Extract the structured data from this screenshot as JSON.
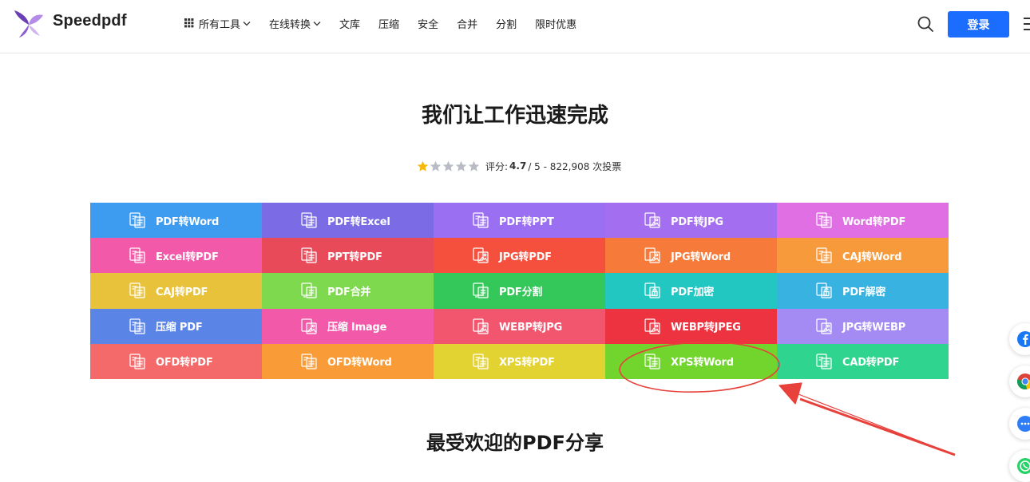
{
  "brand": {
    "name": "Speedpdf"
  },
  "nav": {
    "items": [
      {
        "label": "所有工具",
        "grid_icon": true,
        "dropdown": true
      },
      {
        "label": "在线转换",
        "grid_icon": false,
        "dropdown": true
      },
      {
        "label": "文库",
        "grid_icon": false,
        "dropdown": false
      },
      {
        "label": "压缩",
        "grid_icon": false,
        "dropdown": false
      },
      {
        "label": "安全",
        "grid_icon": false,
        "dropdown": false
      },
      {
        "label": "合并",
        "grid_icon": false,
        "dropdown": false
      },
      {
        "label": "分割",
        "grid_icon": false,
        "dropdown": false
      },
      {
        "label": "限时优惠",
        "grid_icon": false,
        "dropdown": false
      }
    ],
    "login_label": "登录"
  },
  "hero": {
    "title": "我们让工作迅速完成",
    "rating": {
      "label": "评分:",
      "score": "4.7",
      "rest": "/ 5 - 822,908 次投票",
      "stars_total": 5,
      "stars_filled": 1
    }
  },
  "tools": [
    {
      "label": "PDF转Word",
      "color": "#3d9cf0",
      "icon": "pdf-doc-icon"
    },
    {
      "label": "PDF转Excel",
      "color": "#7b6ce6",
      "icon": "pdf-doc-icon"
    },
    {
      "label": "PDF转PPT",
      "color": "#9b6ff2",
      "icon": "pdf-doc-icon"
    },
    {
      "label": "PDF转JPG",
      "color": "#a46ef0",
      "icon": "pdf-image-icon"
    },
    {
      "label": "Word转PDF",
      "color": "#df6fe3",
      "icon": "word-doc-icon"
    },
    {
      "label": "Excel转PDF",
      "color": "#f25aa9",
      "icon": "excel-doc-icon"
    },
    {
      "label": "PPT转PDF",
      "color": "#e84a5a",
      "icon": "ppt-doc-icon"
    },
    {
      "label": "JPG转PDF",
      "color": "#f5503d",
      "icon": "image-doc-icon"
    },
    {
      "label": "JPG转Word",
      "color": "#f67a3a",
      "icon": "image-doc-icon"
    },
    {
      "label": "CAJ转Word",
      "color": "#f79a3c",
      "icon": "caj-doc-icon"
    },
    {
      "label": "CAJ转PDF",
      "color": "#e8c23a",
      "icon": "caj-doc-icon"
    },
    {
      "label": "PDF合并",
      "color": "#7fd94e",
      "icon": "merge-icon"
    },
    {
      "label": "PDF分割",
      "color": "#34c759",
      "icon": "split-icon"
    },
    {
      "label": "PDF加密",
      "color": "#22c7c2",
      "icon": "lock-icon"
    },
    {
      "label": "PDF解密",
      "color": "#38b2e0",
      "icon": "unlock-icon"
    },
    {
      "label": "压缩 PDF",
      "color": "#5a84e6",
      "icon": "compress-pdf-icon"
    },
    {
      "label": "压缩 Image",
      "color": "#f25aa9",
      "icon": "compress-image-icon"
    },
    {
      "label": "WEBP转JPG",
      "color": "#f2566e",
      "icon": "webp-image-icon"
    },
    {
      "label": "WEBP转JPEG",
      "color": "#ee3340",
      "icon": "webp-image-icon"
    },
    {
      "label": "JPG转WEBP",
      "color": "#a38bf3",
      "icon": "jpg-image-icon"
    },
    {
      "label": "OFD转PDF",
      "color": "#f46a6a",
      "icon": "ofd-doc-icon"
    },
    {
      "label": "OFD转Word",
      "color": "#f99c38",
      "icon": "ofd-doc-icon"
    },
    {
      "label": "XPS转PDF",
      "color": "#e2d232",
      "icon": "xps-doc-icon"
    },
    {
      "label": "XPS转Word",
      "color": "#72d52d",
      "icon": "xps-doc-icon"
    },
    {
      "label": "CAD转PDF",
      "color": "#2fd48e",
      "icon": "cad-doc-icon"
    }
  ],
  "popular": {
    "title": "最受欢迎的PDF分享"
  },
  "colors": {
    "accent": "#1a6dff",
    "annotation": "#e8403a"
  },
  "float_buttons": [
    {
      "icon": "facebook-icon"
    },
    {
      "icon": "chrome-icon"
    },
    {
      "icon": "chat-icon"
    },
    {
      "icon": "whatsapp-icon"
    }
  ]
}
